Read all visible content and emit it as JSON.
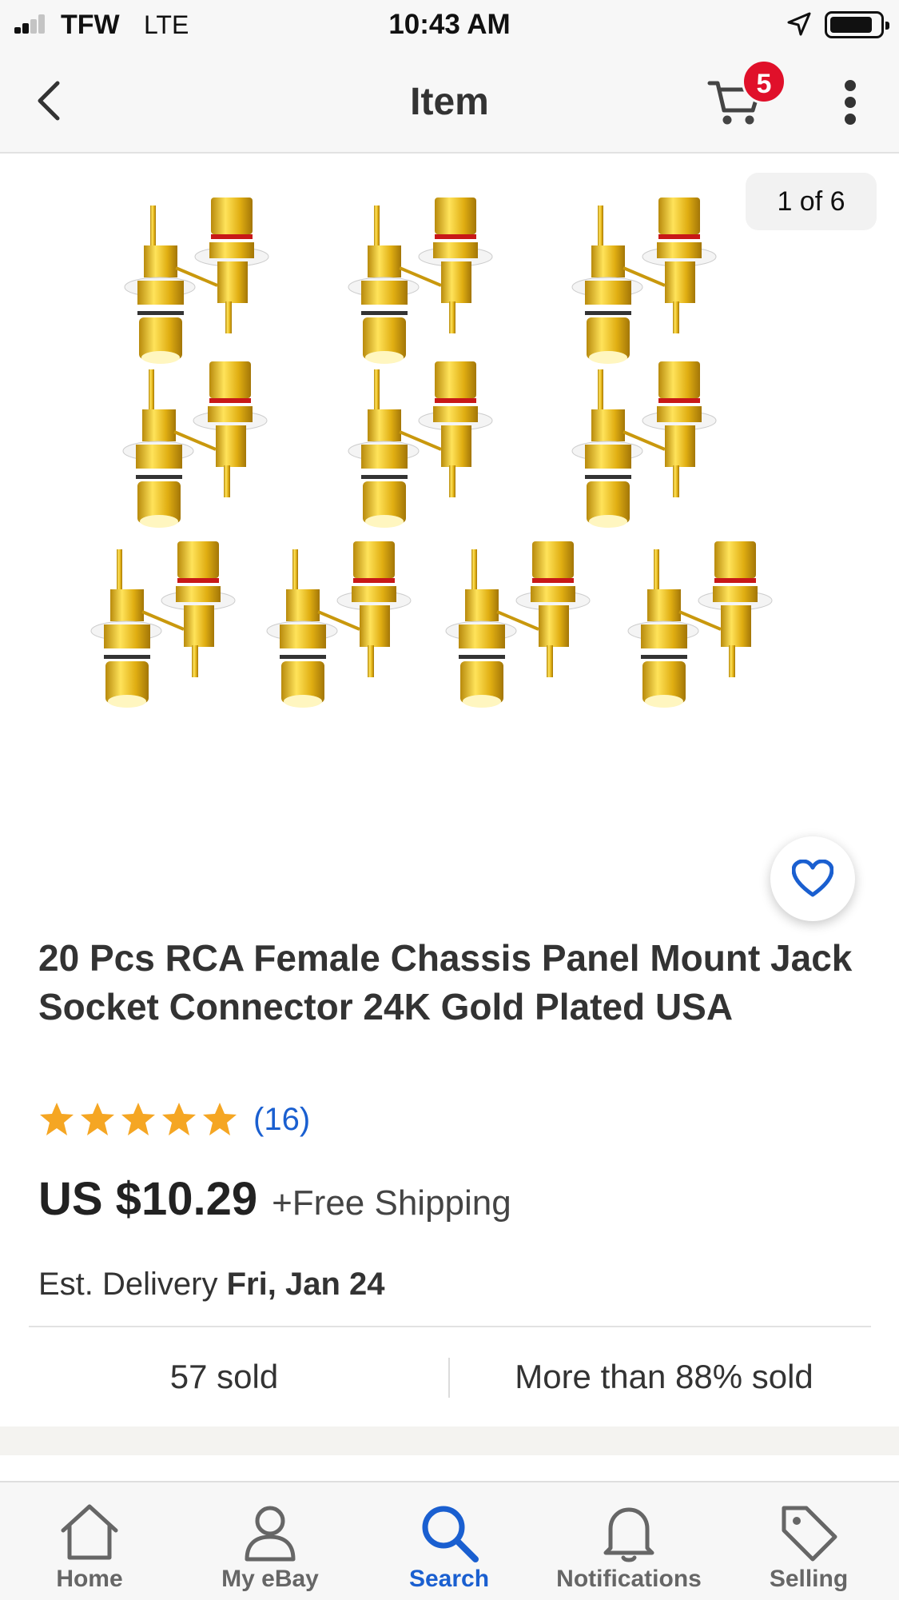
{
  "status_bar": {
    "carrier": "TFW",
    "network": "LTE",
    "time": "10:43 AM"
  },
  "header": {
    "title": "Item",
    "cart_count": "5",
    "icons": [
      "back-arrow",
      "shopping-cart",
      "more-vertical"
    ]
  },
  "gallery": {
    "counter": "1 of 6"
  },
  "product": {
    "title": "20 Pcs RCA Female Chassis Panel Mount Jack Socket Connector 24K Gold Plated USA",
    "rating_stars": 5,
    "review_count": "(16)",
    "price": "US $10.29",
    "shipping": "+Free Shipping",
    "delivery_label": "Est. Delivery",
    "delivery_date": "Fri, Jan 24",
    "sold": "57 sold",
    "sold_percent": "More than 88% sold"
  },
  "tabs": [
    {
      "label": "Home",
      "icon": "home-icon"
    },
    {
      "label": "My eBay",
      "icon": "person-icon"
    },
    {
      "label": "Search",
      "icon": "search-icon",
      "active": true
    },
    {
      "label": "Notifications",
      "icon": "bell-icon"
    },
    {
      "label": "Selling",
      "icon": "tag-icon"
    }
  ],
  "colors": {
    "accent_blue": "#1a5fd0",
    "badge_red": "#e0102a",
    "star_orange": "#f5a623",
    "gold": "#e3b51b"
  }
}
